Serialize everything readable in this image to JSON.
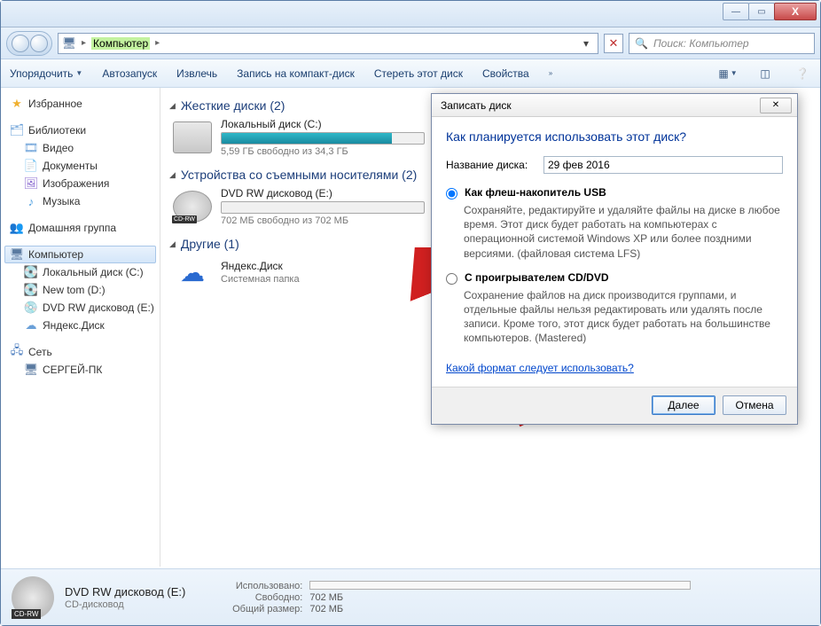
{
  "titlebar": {
    "min": "—",
    "max": "▭",
    "close": "X"
  },
  "address": {
    "computer": "Компьютер",
    "search_placeholder": "Поиск: Компьютер"
  },
  "toolbar": {
    "organize": "Упорядочить",
    "autoplay": "Автозапуск",
    "eject": "Извлечь",
    "burn": "Запись на компакт-диск",
    "erase": "Стереть этот диск",
    "properties": "Свойства"
  },
  "sidebar": {
    "favorites": "Избранное",
    "libraries": "Библиотеки",
    "videos": "Видео",
    "documents": "Документы",
    "pictures": "Изображения",
    "music": "Музыка",
    "homegroup": "Домашняя группа",
    "computer": "Компьютер",
    "localdisk": "Локальный диск (C:)",
    "newtom": "New tom (D:)",
    "dvdrw": "DVD RW дисковод (E:)",
    "yadisk": "Яндекс.Диск",
    "network": "Сеть",
    "sergpk": "СЕРГЕЙ-ПК"
  },
  "content": {
    "hdd_header": "Жесткие диски (2)",
    "localc_title": "Локальный диск (C:)",
    "localc_sub": "5,59 ГБ свободно из 34,3 ГБ",
    "removable_header": "Устройства со съемными носителями (2)",
    "dvd_title": "DVD RW дисковод (E:)",
    "dvd_sub": "702 МБ свободно из 702 МБ",
    "other_header": "Другие (1)",
    "yadisk_title": "Яндекс.Диск",
    "yadisk_sub": "Системная папка"
  },
  "dialog": {
    "title": "Записать диск",
    "question": "Как планируется использовать этот диск?",
    "name_label": "Название диска:",
    "name_value": "29 фев 2016",
    "opt1_title": "Как флеш-накопитель USB",
    "opt1_desc": "Сохраняйте, редактируйте и удаляйте файлы на диске в любое время. Этот диск будет работать на компьютерах с операционной системой Windows XP или более поздними версиями. (файловая система LFS)",
    "opt2_title": "С проигрывателем CD/DVD",
    "opt2_desc": "Сохранение файлов на диск производится группами, и отдельные файлы нельзя редактировать или удалять после записи. Кроме того, этот диск будет работать на большинстве компьютеров. (Mastered)",
    "link": "Какой формат следует использовать?",
    "next": "Далее",
    "cancel": "Отмена"
  },
  "status": {
    "title": "DVD RW дисковод (E:)",
    "sub": "CD-дисковод",
    "used_lbl": "Использовано:",
    "free_lbl": "Свободно:",
    "free_val": "702 МБ",
    "total_lbl": "Общий размер:",
    "total_val": "702 МБ"
  }
}
